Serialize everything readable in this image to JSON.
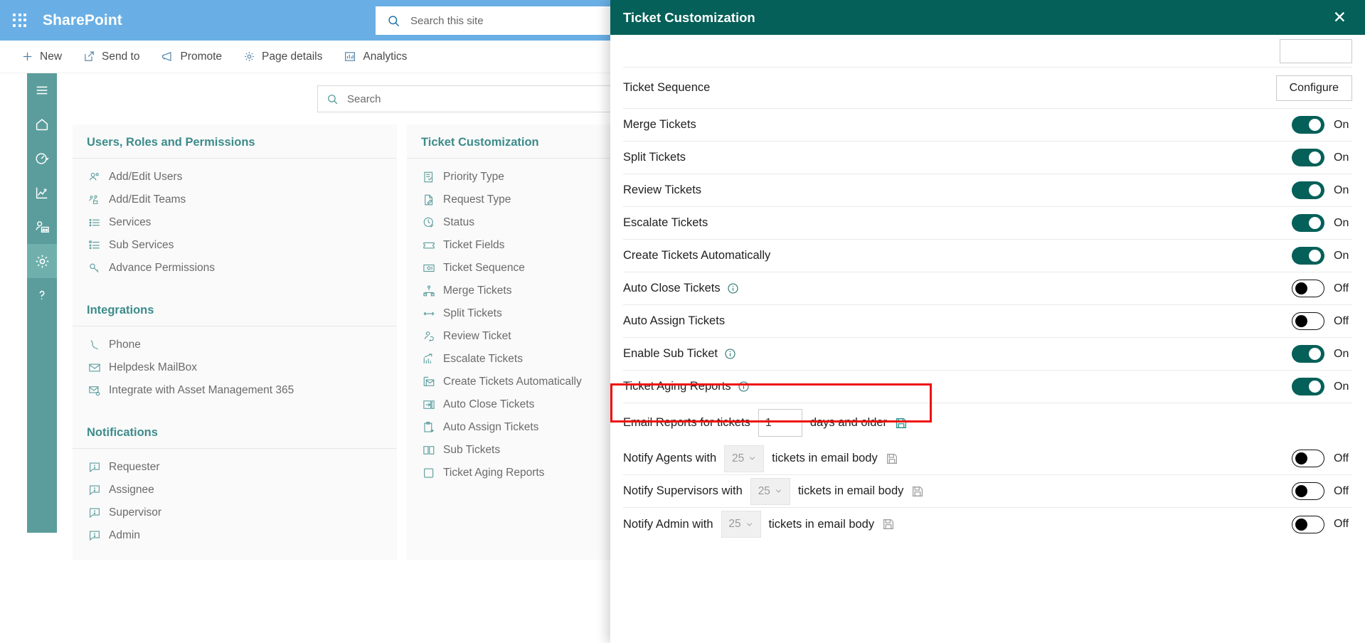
{
  "suite": {
    "waffle_icon": "app-launcher-icon",
    "brand": "SharePoint",
    "search_placeholder": "Search this site",
    "search_value": "",
    "search_icon": "search-icon"
  },
  "command_bar": {
    "items": [
      {
        "label": "New",
        "icon": "plus-icon"
      },
      {
        "label": "Send to",
        "icon": "send-to-icon"
      },
      {
        "label": "Promote",
        "icon": "megaphone-icon"
      },
      {
        "label": "Page details",
        "icon": "gear-icon"
      },
      {
        "label": "Analytics",
        "icon": "bar-chart-icon"
      }
    ]
  },
  "rail": {
    "items": [
      {
        "icon": "hamburger-icon",
        "name": "menu",
        "active": false
      },
      {
        "icon": "home-icon",
        "name": "home",
        "active": false
      },
      {
        "icon": "dashboard-icon",
        "name": "dashboard",
        "active": false
      },
      {
        "icon": "reports-icon",
        "name": "reports",
        "active": false
      },
      {
        "icon": "team-icon",
        "name": "teams",
        "active": false
      },
      {
        "icon": "gear-icon",
        "name": "settings",
        "active": true
      },
      {
        "icon": "help-icon",
        "name": "help",
        "active": false
      }
    ]
  },
  "page_search": {
    "placeholder": "Search",
    "value": "",
    "icon": "search-icon"
  },
  "columns": [
    {
      "title": "Users, Roles and Permissions",
      "items": [
        {
          "label": "Add/Edit Users",
          "icon": "users-icon"
        },
        {
          "label": "Add/Edit Teams",
          "icon": "team-group-icon"
        },
        {
          "label": "Services",
          "icon": "list-icon"
        },
        {
          "label": "Sub Services",
          "icon": "sub-list-icon"
        },
        {
          "label": "Advance Permissions",
          "icon": "key-icon"
        }
      ]
    },
    {
      "title": "Integrations",
      "items": [
        {
          "label": "Phone",
          "icon": "phone-icon"
        },
        {
          "label": "Helpdesk MailBox",
          "icon": "mail-icon"
        },
        {
          "label": "Integrate with Asset Management 365",
          "icon": "mail-gear-icon"
        }
      ]
    },
    {
      "title": "Notifications",
      "items": [
        {
          "label": "Requester",
          "icon": "comment-alert-icon"
        },
        {
          "label": "Assignee",
          "icon": "comment-alert-icon"
        },
        {
          "label": "Supervisor",
          "icon": "comment-alert-icon"
        },
        {
          "label": "Admin",
          "icon": "comment-alert-icon"
        }
      ]
    },
    {
      "title": "Ticket Customization",
      "items": [
        {
          "label": "Priority Type",
          "icon": "priority-list-icon"
        },
        {
          "label": "Request Type",
          "icon": "document-edit-icon"
        },
        {
          "label": "Status",
          "icon": "clock-check-icon"
        },
        {
          "label": "Ticket Fields",
          "icon": "ticket-icon"
        },
        {
          "label": "Ticket Sequence",
          "icon": "sequence-icon"
        },
        {
          "label": "Merge Tickets",
          "icon": "merge-icon"
        },
        {
          "label": "Split Tickets",
          "icon": "split-arrows-icon"
        },
        {
          "label": "Review Ticket",
          "icon": "review-people-icon"
        },
        {
          "label": "Escalate Tickets",
          "icon": "escalate-chart-icon"
        },
        {
          "label": "Create Tickets Automatically",
          "icon": "create-mail-icon"
        },
        {
          "label": "Auto Close Tickets",
          "icon": "auto-close-icon"
        },
        {
          "label": "Auto Assign Tickets",
          "icon": "clipboard-assign-icon"
        },
        {
          "label": "Sub Tickets",
          "icon": "sub-tickets-icon"
        },
        {
          "label": "Ticket Aging Reports",
          "icon": "square-icon"
        }
      ]
    }
  ],
  "panel": {
    "title": "Ticket Customization",
    "close_icon": "close-icon",
    "rows": [
      {
        "type": "button",
        "label": "",
        "button_label": "",
        "partial": true
      },
      {
        "type": "button",
        "label": "Ticket Sequence",
        "button_label": "Configure"
      },
      {
        "type": "toggle",
        "label": "Merge Tickets",
        "state": "On",
        "on": true
      },
      {
        "type": "toggle",
        "label": "Split Tickets",
        "state": "On",
        "on": true
      },
      {
        "type": "toggle",
        "label": "Review Tickets",
        "state": "On",
        "on": true
      },
      {
        "type": "toggle",
        "label": "Escalate Tickets",
        "state": "On",
        "on": true
      },
      {
        "type": "toggle",
        "label": "Create Tickets Automatically",
        "state": "On",
        "on": true
      },
      {
        "type": "toggle",
        "label": "Auto Close Tickets",
        "state": "Off",
        "on": false,
        "info": true
      },
      {
        "type": "toggle",
        "label": "Auto Assign Tickets",
        "state": "Off",
        "on": false
      },
      {
        "type": "toggle",
        "label": "Enable Sub Ticket",
        "state": "On",
        "on": true,
        "info": true
      },
      {
        "type": "toggle",
        "label": "Ticket Aging Reports",
        "state": "On",
        "on": true,
        "info": true
      }
    ],
    "email_reports": {
      "label_before": "Email Reports for tickets",
      "value": "1",
      "label_after": "days and older",
      "save_icon": "save-icon",
      "highlight_color": "#ee1111"
    },
    "notify_rows": [
      {
        "label_before": "Notify Agents with",
        "select_value": "25",
        "label_after": "tickets in email body",
        "save_icon": "save-icon",
        "state": "Off",
        "on": false
      },
      {
        "label_before": "Notify Supervisors with",
        "select_value": "25",
        "label_after": "tickets in email body",
        "save_icon": "save-icon",
        "state": "Off",
        "on": false
      },
      {
        "label_before": "Notify Admin with",
        "select_value": "25",
        "label_after": "tickets in email body",
        "save_icon": "save-icon",
        "state": "Off",
        "on": false
      }
    ]
  },
  "colors": {
    "suitebar": "#69afe5",
    "rail": "#5b9d9c",
    "panel_header": "#046058",
    "accent_teal": "#3d8b8b",
    "toggle_on": "#046058",
    "highlight": "#ee1111"
  }
}
